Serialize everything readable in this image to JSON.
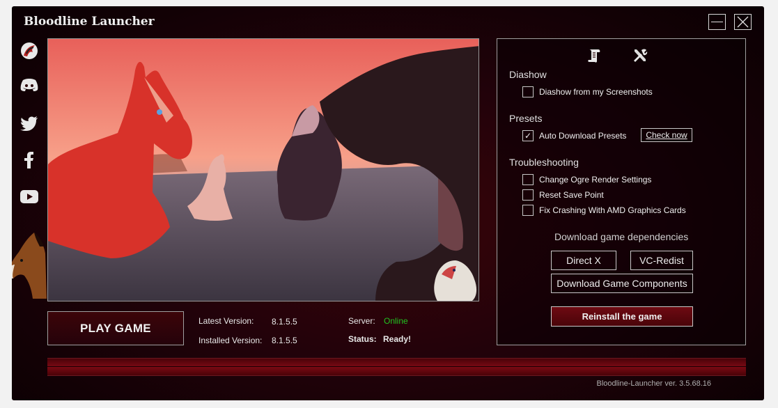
{
  "window": {
    "title": "Bloodline Launcher"
  },
  "social": [
    "bloodline-logo-icon",
    "discord-icon",
    "twitter-icon",
    "facebook-icon",
    "youtube-icon"
  ],
  "play": {
    "label": "PLAY GAME"
  },
  "versions": {
    "latest_label": "Latest Version:",
    "latest_value": "8.1.5.5",
    "installed_label": "Installed Version:",
    "installed_value": "8.1.5.5"
  },
  "server": {
    "server_label": "Server:",
    "server_value": "Online",
    "status_label": "Status:",
    "status_value": "Ready!"
  },
  "panel": {
    "tabs": [
      "scroll-icon",
      "tools-icon"
    ],
    "diashow": {
      "heading": "Diashow",
      "option": "Diashow from my Screenshots",
      "checked": false
    },
    "presets": {
      "heading": "Presets",
      "option": "Auto Download Presets",
      "checked": true,
      "button": "Check now"
    },
    "troubleshooting": {
      "heading": "Troubleshooting",
      "options": [
        {
          "label": "Change Ogre Render Settings",
          "checked": false
        },
        {
          "label": "Reset Save Point",
          "checked": false
        },
        {
          "label": "Fix Crashing With AMD Graphics Cards",
          "checked": false
        }
      ]
    },
    "dependencies": {
      "heading": "Download game dependencies",
      "directx": "Direct X",
      "vcredist": "VC-Redist",
      "components": "Download Game Components"
    },
    "reinstall": "Reinstall the game"
  },
  "footer": {
    "version": "Bloodline-Launcher ver. 3.5.68.16"
  },
  "colors": {
    "accent": "#7a0a14",
    "online": "#21c321",
    "background": "#22020a"
  }
}
